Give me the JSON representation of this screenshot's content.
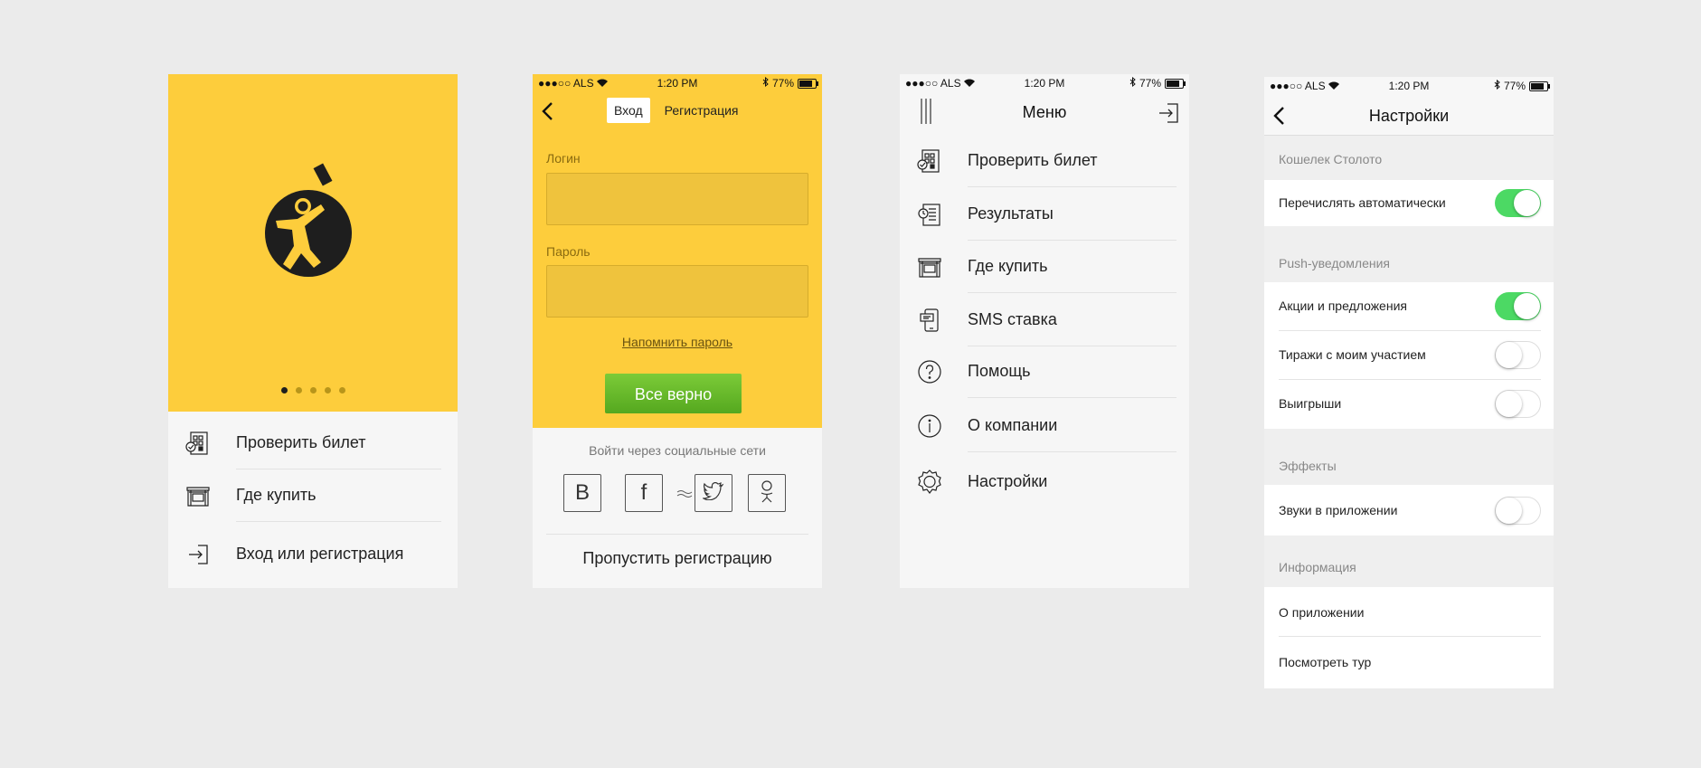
{
  "splash": {
    "pager": {
      "count": 5,
      "active": 0
    },
    "items": [
      {
        "label": "Проверить билет",
        "icon": "ticket-check-icon"
      },
      {
        "label": "Где купить",
        "icon": "store-icon"
      },
      {
        "label": "Вход или регистрация",
        "icon": "login-icon"
      }
    ]
  },
  "statusbar": {
    "carrier": "●●●○○ ALS",
    "time": "1:20 PM",
    "battery": "77%"
  },
  "login": {
    "tabs": [
      "Вход",
      "Регистрация"
    ],
    "login_label": "Логин",
    "password_label": "Пароль",
    "login_value": "",
    "password_value": "",
    "remind_link": "Напомнить пароль",
    "submit": "Все верно",
    "social_title": "Войти через социальные сети",
    "social": [
      {
        "name": "vk",
        "glyph": "В"
      },
      {
        "name": "facebook",
        "glyph": "f"
      },
      {
        "name": "twitter",
        "glyph": ""
      },
      {
        "name": "odnoklassniki",
        "glyph": ""
      }
    ],
    "skip": "Пропустить регистрацию"
  },
  "menu": {
    "title": "Меню",
    "items": [
      {
        "label": "Проверить билет",
        "icon": "ticket-check-icon"
      },
      {
        "label": "Результаты",
        "icon": "results-icon"
      },
      {
        "label": "Где купить",
        "icon": "store-icon"
      },
      {
        "label": "SMS ставка",
        "icon": "sms-icon"
      },
      {
        "label": "Помощь",
        "icon": "help-icon"
      },
      {
        "label": "О компании",
        "icon": "info-icon"
      },
      {
        "label": "Настройки",
        "icon": "gear-icon"
      }
    ]
  },
  "settings": {
    "title": "Настройки",
    "sections": [
      {
        "title": "Кошелек Столото",
        "rows": [
          {
            "label": "Перечислять автоматически",
            "on": true
          }
        ]
      },
      {
        "title": "Push-уведомления",
        "rows": [
          {
            "label": "Акции и предложения",
            "on": true
          },
          {
            "label": "Тиражи с моим участием",
            "on": false
          },
          {
            "label": "Выигрыши",
            "on": false
          }
        ]
      },
      {
        "title": "Эффекты",
        "rows": [
          {
            "label": "Звуки в приложении",
            "on": false
          }
        ]
      },
      {
        "title": "Информация",
        "rows": [
          {
            "label": "О приложении"
          },
          {
            "label": "Посмотреть тур"
          }
        ]
      }
    ]
  },
  "colors": {
    "yellow": "#fdcd3c",
    "green_toggle": "#4cd964",
    "button_green": "#6cbd2e"
  }
}
